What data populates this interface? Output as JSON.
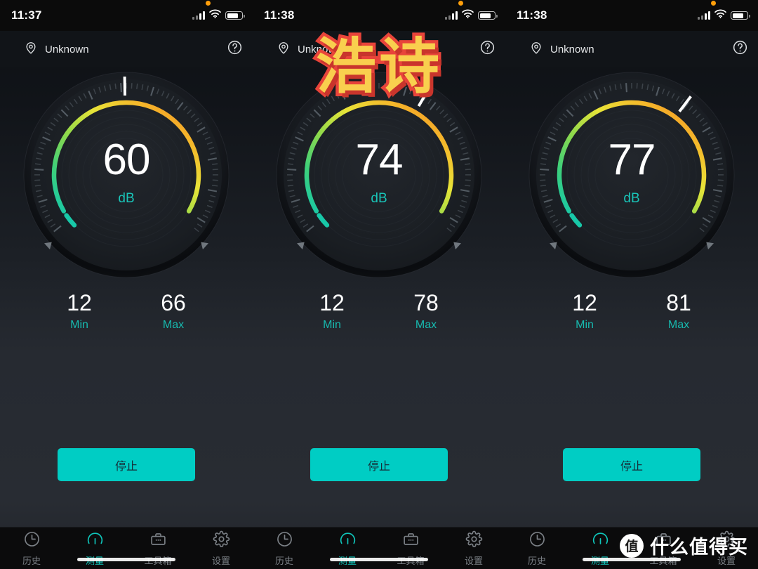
{
  "app": {
    "unit": "dB",
    "accent": "#00cdc4",
    "background": "#282c33",
    "arc_colors": [
      "#18c8a8",
      "#3ed07a",
      "#8fd94b",
      "#e8e438",
      "#f5b52a",
      "#ef7a22"
    ]
  },
  "watermarks": {
    "top_text": "浩诗",
    "top_fill": "#f9cf4e",
    "top_stroke": "#e8443a",
    "brand_badge": "值",
    "brand_text": "什么值得买"
  },
  "panels": [
    {
      "statusbar": {
        "time": "11:37",
        "mic_indicator": true,
        "signal_bars": 4,
        "wifi": true,
        "battery_percent": 78
      },
      "header": {
        "location_icon": "location-pin-icon",
        "location": "Unknown",
        "help_icon": "help-circle-icon"
      },
      "gauge": {
        "value": "60",
        "unit": "dB",
        "needle_angle": -1,
        "arc_start": 145,
        "arc_end": 395
      },
      "stats": [
        {
          "num": "12",
          "cap": "Min"
        },
        {
          "num": "66",
          "cap": "Max"
        }
      ],
      "action": {
        "label": "停止"
      },
      "tabs": [
        {
          "label": "历史",
          "icon": "clock-icon",
          "active": false
        },
        {
          "label": "测量",
          "icon": "gauge-icon",
          "active": true
        },
        {
          "label": "工具箱",
          "icon": "toolbox-icon",
          "active": false
        },
        {
          "label": "设置",
          "icon": "gear-icon",
          "active": false
        }
      ]
    },
    {
      "statusbar": {
        "time": "11:38",
        "mic_indicator": true,
        "signal_bars": 4,
        "wifi": true,
        "battery_percent": 78
      },
      "header": {
        "location_icon": "location-pin-icon",
        "location": "Unknown",
        "help_icon": "help-circle-icon"
      },
      "gauge": {
        "value": "74",
        "unit": "dB",
        "needle_angle": 30,
        "arc_start": 145,
        "arc_end": 395
      },
      "stats": [
        {
          "num": "12",
          "cap": "Min"
        },
        {
          "num": "78",
          "cap": "Max"
        }
      ],
      "action": {
        "label": "停止"
      },
      "tabs": [
        {
          "label": "历史",
          "icon": "clock-icon",
          "active": false
        },
        {
          "label": "测量",
          "icon": "gauge-icon",
          "active": true
        },
        {
          "label": "工具箱",
          "icon": "toolbox-icon",
          "active": false
        },
        {
          "label": "设置",
          "icon": "gear-icon",
          "active": false
        }
      ]
    },
    {
      "statusbar": {
        "time": "11:38",
        "mic_indicator": true,
        "signal_bars": 4,
        "wifi": true,
        "battery_percent": 78
      },
      "header": {
        "location_icon": "location-pin-icon",
        "location": "Unknown",
        "help_icon": "help-circle-icon"
      },
      "gauge": {
        "value": "77",
        "unit": "dB",
        "needle_angle": 37,
        "arc_start": 145,
        "arc_end": 395
      },
      "stats": [
        {
          "num": "12",
          "cap": "Min"
        },
        {
          "num": "81",
          "cap": "Max"
        }
      ],
      "action": {
        "label": "停止"
      },
      "tabs": [
        {
          "label": "历史",
          "icon": "clock-icon",
          "active": false
        },
        {
          "label": "测量",
          "icon": "gauge-icon",
          "active": true
        },
        {
          "label": "工具箱",
          "icon": "toolbox-icon",
          "active": false
        },
        {
          "label": "设置",
          "icon": "gear-icon",
          "active": false
        }
      ]
    }
  ]
}
